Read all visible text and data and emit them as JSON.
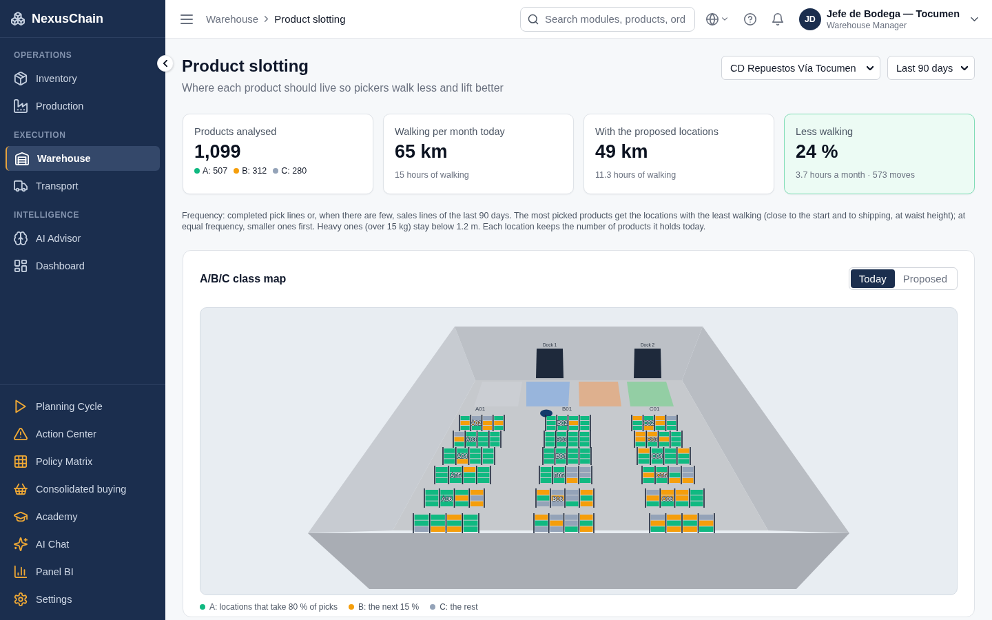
{
  "sidebar": {
    "brand": "NexusChain",
    "sections": [
      {
        "title": "OPERATIONS",
        "items": [
          {
            "label": "Inventory",
            "selected": false
          },
          {
            "label": "Production",
            "selected": false
          }
        ]
      },
      {
        "title": "EXECUTION",
        "items": [
          {
            "label": "Warehouse",
            "selected": true
          },
          {
            "label": "Transport",
            "selected": false
          }
        ]
      },
      {
        "title": "INTELLIGENCE",
        "items": [
          {
            "label": "AI Advisor",
            "selected": false
          },
          {
            "label": "Dashboard",
            "selected": false
          }
        ]
      }
    ],
    "pinned_items": [
      {
        "label": "Planning Cycle",
        "selected": false
      },
      {
        "label": "Action Center",
        "selected": false
      },
      {
        "label": "Policy Matrix",
        "selected": false
      },
      {
        "label": "Consolidated buying",
        "selected": false
      },
      {
        "label": "Academy",
        "selected": false
      },
      {
        "label": "AI Chat",
        "selected": false
      },
      {
        "label": "Panel BI",
        "selected": false
      },
      {
        "label": "Settings",
        "selected": false
      }
    ]
  },
  "header": {
    "breadcrumbs": [
      {
        "label": "Warehouse"
      },
      {
        "label": "Product slotting"
      }
    ],
    "search": {
      "placeholder": "Search modules, products, ord"
    },
    "user": {
      "initials": "JD",
      "name": "Jefe de Bodega — Tocumen",
      "role": "Warehouse Manager"
    }
  },
  "page": {
    "title": "Product slotting",
    "subtitle": "Where each product should live so pickers walk less and lift better",
    "filters": [
      {
        "value": "CD Repuestos Vía Tocumen"
      },
      {
        "value": "Last 90 days"
      }
    ]
  },
  "kpis": [
    {
      "label": "Products analysed",
      "value": "1,099",
      "breakdown": [
        {
          "label": "A: 507",
          "color": "#10b981"
        },
        {
          "label": "B: 312",
          "color": "#f59e0b"
        },
        {
          "label": "C: 280",
          "color": "#94a3b8"
        }
      ],
      "highlighted": false
    },
    {
      "label": "Walking per month today",
      "value": "65 km",
      "note": "15 hours of walking",
      "highlighted": false
    },
    {
      "label": "With the proposed locations",
      "value": "49 km",
      "note": "11.3 hours of walking",
      "highlighted": false
    },
    {
      "label": "Less walking",
      "value": "24 %",
      "note": "3.7 hours a month · 573 moves",
      "highlighted": true
    }
  ],
  "method_note": "Frequency: completed pick lines or, when there are few, sales lines of the last 90 days. The most picked products get the locations with the least walking (close to the start and to shipping, at waist height); at equal frequency, smaller ones first. Heavy ones (over 15 kg) stay below 1.2 m. Each location keeps the number of products it holds today.",
  "class_map": {
    "title": "A/B/C class map",
    "views": [
      {
        "label": "Today",
        "selected": true
      },
      {
        "label": "Proposed",
        "selected": false
      }
    ],
    "docks": [
      {
        "label": "Dock 1"
      },
      {
        "label": "Dock 2"
      }
    ],
    "zones": [
      {
        "color": "#cbced3"
      },
      {
        "color": "#98b5dc"
      },
      {
        "color": "#deb08e"
      },
      {
        "color": "#93cea4"
      }
    ],
    "aisles": [
      {
        "label": "A01",
        "racks": [
          {
            "label": "A02",
            "bays": [
              [
                {
                  "color": "#10b981"
                },
                {
                  "color": "#f59e0b"
                },
                {
                  "color": "#10b981"
                }
              ],
              [
                {
                  "color": "#94a3b8"
                },
                {
                  "color": "#f59e0b"
                },
                {
                  "color": "#10b981"
                }
              ],
              [
                {
                  "color": "#94a3b8"
                },
                {
                  "color": "#f59e0b"
                },
                {
                  "color": "#f59e0b"
                }
              ],
              [
                {
                  "color": "#10b981"
                },
                {
                  "color": "#f59e0b"
                },
                {
                  "color": "#10b981"
                }
              ]
            ]
          },
          {
            "label": "A03",
            "bays": [
              [
                {
                  "color": "#94a3b8"
                },
                {
                  "color": "#f59e0b"
                },
                {
                  "color": "#10b981"
                }
              ],
              [
                {
                  "color": "#10b981"
                },
                {
                  "color": "#10b981"
                },
                {
                  "color": "#10b981"
                }
              ],
              [
                {
                  "color": "#10b981"
                },
                {
                  "color": "#10b981"
                },
                {
                  "color": "#10b981"
                }
              ],
              [
                {
                  "color": "#10b981"
                },
                {
                  "color": "#10b981"
                },
                {
                  "color": "#10b981"
                }
              ]
            ]
          },
          {
            "label": "A04",
            "bays": [
              [
                {
                  "color": "#10b981"
                },
                {
                  "color": "#10b981"
                },
                {
                  "color": "#10b981"
                }
              ],
              [
                {
                  "color": "#10b981"
                },
                {
                  "color": "#10b981"
                },
                {
                  "color": "#f59e0b"
                }
              ],
              [
                {
                  "color": "#10b981"
                },
                {
                  "color": "#10b981"
                },
                {
                  "color": "#10b981"
                }
              ],
              [
                {
                  "color": "#10b981"
                },
                {
                  "color": "#10b981"
                },
                {
                  "color": "#10b981"
                }
              ]
            ]
          },
          {
            "label": "A05",
            "bays": [
              [
                {
                  "color": "#10b981"
                },
                {
                  "color": "#10b981"
                },
                {
                  "color": "#10b981"
                }
              ],
              [
                {
                  "color": "#10b981"
                },
                {
                  "color": "#10b981"
                },
                {
                  "color": "#10b981"
                }
              ],
              [
                {
                  "color": "#f59e0b"
                },
                {
                  "color": "#10b981"
                },
                {
                  "color": "#10b981"
                }
              ],
              [
                {
                  "color": "#10b981"
                },
                {
                  "color": "#10b981"
                },
                {
                  "color": "#10b981"
                }
              ]
            ]
          },
          {
            "label": "A06",
            "bays": [
              [
                {
                  "color": "#10b981"
                },
                {
                  "color": "#10b981"
                },
                {
                  "color": "#10b981"
                }
              ],
              [
                {
                  "color": "#10b981"
                },
                {
                  "color": "#10b981"
                },
                {
                  "color": "#10b981"
                }
              ],
              [
                {
                  "color": "#10b981"
                },
                {
                  "color": "#f59e0b"
                },
                {
                  "color": "#10b981"
                }
              ],
              [
                {
                  "color": "#f59e0b"
                },
                {
                  "color": "#94a3b8"
                },
                {
                  "color": "#f59e0b"
                }
              ]
            ]
          },
          {
            "bays": [
              [
                {
                  "color": "#10b981"
                },
                {
                  "color": "#10b981"
                },
                {
                  "color": "#94a3b8"
                }
              ],
              [
                {
                  "color": "#10b981"
                },
                {
                  "color": "#10b981"
                },
                {
                  "color": "#f59e0b"
                }
              ],
              [
                {
                  "color": "#f59e0b"
                },
                {
                  "color": "#10b981"
                },
                {
                  "color": "#f59e0b"
                }
              ],
              [
                {
                  "color": "#10b981"
                },
                {
                  "color": "#10b981"
                },
                {
                  "color": "#10b981"
                }
              ]
            ]
          }
        ]
      },
      {
        "label": "B01",
        "racks": [
          {
            "label": "B02",
            "bays": [
              [
                {
                  "color": "#10b981"
                },
                {
                  "color": "#10b981"
                },
                {
                  "color": "#10b981"
                }
              ],
              [
                {
                  "color": "#10b981"
                },
                {
                  "color": "#10b981"
                },
                {
                  "color": "#10b981"
                }
              ],
              [
                {
                  "color": "#10b981"
                },
                {
                  "color": "#f59e0b"
                },
                {
                  "color": "#10b981"
                }
              ],
              [
                {
                  "color": "#10b981"
                },
                {
                  "color": "#10b981"
                },
                {
                  "color": "#10b981"
                }
              ]
            ]
          },
          {
            "label": "B03",
            "bays": [
              [
                {
                  "color": "#10b981"
                },
                {
                  "color": "#10b981"
                },
                {
                  "color": "#10b981"
                }
              ],
              [
                {
                  "color": "#10b981"
                },
                {
                  "color": "#10b981"
                },
                {
                  "color": "#10b981"
                }
              ],
              [
                {
                  "color": "#10b981"
                },
                {
                  "color": "#10b981"
                },
                {
                  "color": "#10b981"
                }
              ],
              [
                {
                  "color": "#10b981"
                },
                {
                  "color": "#10b981"
                },
                {
                  "color": "#10b981"
                }
              ]
            ]
          },
          {
            "label": "B04",
            "bays": [
              [
                {
                  "color": "#10b981"
                },
                {
                  "color": "#10b981"
                },
                {
                  "color": "#10b981"
                }
              ],
              [
                {
                  "color": "#10b981"
                },
                {
                  "color": "#10b981"
                },
                {
                  "color": "#10b981"
                }
              ],
              [
                {
                  "color": "#10b981"
                },
                {
                  "color": "#10b981"
                },
                {
                  "color": "#10b981"
                }
              ],
              [
                {
                  "color": "#10b981"
                },
                {
                  "color": "#10b981"
                },
                {
                  "color": "#10b981"
                }
              ]
            ]
          },
          {
            "label": "B05",
            "bays": [
              [
                {
                  "color": "#10b981"
                },
                {
                  "color": "#10b981"
                },
                {
                  "color": "#10b981"
                }
              ],
              [
                {
                  "color": "#10b981"
                },
                {
                  "color": "#10b981"
                },
                {
                  "color": "#10b981"
                }
              ],
              [
                {
                  "color": "#94a3b8"
                },
                {
                  "color": "#94a3b8"
                },
                {
                  "color": "#f59e0b"
                }
              ],
              [
                {
                  "color": "#94a3b8"
                },
                {
                  "color": "#94a3b8"
                },
                {
                  "color": "#10b981"
                }
              ]
            ]
          },
          {
            "label": "B06",
            "bays": [
              [
                {
                  "color": "#f59e0b"
                },
                {
                  "color": "#10b981"
                },
                {
                  "color": "#94a3b8"
                }
              ],
              [
                {
                  "color": "#94a3b8"
                },
                {
                  "color": "#f59e0b"
                },
                {
                  "color": "#94a3b8"
                }
              ],
              [
                {
                  "color": "#94a3b8"
                },
                {
                  "color": "#94a3b8"
                },
                {
                  "color": "#10b981"
                }
              ],
              [
                {
                  "color": "#f59e0b"
                },
                {
                  "color": "#10b981"
                },
                {
                  "color": "#f59e0b"
                }
              ]
            ]
          },
          {
            "bays": [
              [
                {
                  "color": "#f59e0b"
                },
                {
                  "color": "#10b981"
                },
                {
                  "color": "#94a3b8"
                }
              ],
              [
                {
                  "color": "#94a3b8"
                },
                {
                  "color": "#f59e0b"
                },
                {
                  "color": "#94a3b8"
                }
              ],
              [
                {
                  "color": "#94a3b8"
                },
                {
                  "color": "#94a3b8"
                },
                {
                  "color": "#10b981"
                }
              ],
              [
                {
                  "color": "#f59e0b"
                },
                {
                  "color": "#10b981"
                },
                {
                  "color": "#f59e0b"
                }
              ]
            ]
          }
        ]
      },
      {
        "label": "C01",
        "racks": [
          {
            "label": "C02",
            "bays": [
              [
                {
                  "color": "#f59e0b"
                },
                {
                  "color": "#10b981"
                },
                {
                  "color": "#10b981"
                }
              ],
              [
                {
                  "color": "#10b981"
                },
                {
                  "color": "#10b981"
                },
                {
                  "color": "#f59e0b"
                }
              ],
              [
                {
                  "color": "#f59e0b"
                },
                {
                  "color": "#f59e0b"
                },
                {
                  "color": "#10b981"
                }
              ],
              [
                {
                  "color": "#94a3b8"
                },
                {
                  "color": "#10b981"
                },
                {
                  "color": "#10b981"
                }
              ]
            ]
          },
          {
            "label": "C03",
            "bays": [
              [
                {
                  "color": "#f59e0b"
                },
                {
                  "color": "#f59e0b"
                },
                {
                  "color": "#10b981"
                }
              ],
              [
                {
                  "color": "#f59e0b"
                },
                {
                  "color": "#f59e0b"
                },
                {
                  "color": "#10b981"
                }
              ],
              [
                {
                  "color": "#10b981"
                },
                {
                  "color": "#f59e0b"
                },
                {
                  "color": "#10b981"
                }
              ],
              [
                {
                  "color": "#10b981"
                },
                {
                  "color": "#10b981"
                },
                {
                  "color": "#10b981"
                }
              ]
            ]
          },
          {
            "label": "C04",
            "bays": [
              [
                {
                  "color": "#f59e0b"
                },
                {
                  "color": "#10b981"
                },
                {
                  "color": "#10b981"
                }
              ],
              [
                {
                  "color": "#10b981"
                },
                {
                  "color": "#10b981"
                },
                {
                  "color": "#10b981"
                }
              ],
              [
                {
                  "color": "#10b981"
                },
                {
                  "color": "#10b981"
                },
                {
                  "color": "#10b981"
                }
              ],
              [
                {
                  "color": "#f59e0b"
                },
                {
                  "color": "#10b981"
                },
                {
                  "color": "#10b981"
                }
              ]
            ]
          },
          {
            "label": "C05",
            "bays": [
              [
                {
                  "color": "#10b981"
                },
                {
                  "color": "#f59e0b"
                },
                {
                  "color": "#10b981"
                }
              ],
              [
                {
                  "color": "#10b981"
                },
                {
                  "color": "#f59e0b"
                },
                {
                  "color": "#10b981"
                }
              ],
              [
                {
                  "color": "#94a3b8"
                },
                {
                  "color": "#10b981"
                },
                {
                  "color": "#f59e0b"
                }
              ],
              [
                {
                  "color": "#94a3b8"
                },
                {
                  "color": "#94a3b8"
                },
                {
                  "color": "#f59e0b"
                }
              ]
            ]
          },
          {
            "label": "C06",
            "bays": [
              [
                {
                  "color": "#94a3b8"
                },
                {
                  "color": "#f59e0b"
                },
                {
                  "color": "#10b981"
                }
              ],
              [
                {
                  "color": "#f59e0b"
                },
                {
                  "color": "#f59e0b"
                },
                {
                  "color": "#10b981"
                }
              ],
              [
                {
                  "color": "#f59e0b"
                },
                {
                  "color": "#f59e0b"
                },
                {
                  "color": "#10b981"
                }
              ],
              [
                {
                  "color": "#10b981"
                },
                {
                  "color": "#10b981"
                },
                {
                  "color": "#10b981"
                }
              ]
            ]
          },
          {
            "bays": [
              [
                {
                  "color": "#94a3b8"
                },
                {
                  "color": "#f59e0b"
                },
                {
                  "color": "#10b981"
                }
              ],
              [
                {
                  "color": "#f59e0b"
                },
                {
                  "color": "#10b981"
                },
                {
                  "color": "#f59e0b"
                }
              ],
              [
                {
                  "color": "#f59e0b"
                },
                {
                  "color": "#10b981"
                },
                {
                  "color": "#f59e0b"
                }
              ],
              [
                {
                  "color": "#94a3b8"
                },
                {
                  "color": "#f59e0b"
                },
                {
                  "color": "#10b981"
                }
              ]
            ]
          }
        ]
      }
    ],
    "legend": [
      {
        "label": "A: locations that take 80 % of picks",
        "color": "#10b981"
      },
      {
        "label": "B: the next 15 %",
        "color": "#f59e0b"
      },
      {
        "label": "C: the rest",
        "color": "#94a3b8"
      }
    ]
  }
}
